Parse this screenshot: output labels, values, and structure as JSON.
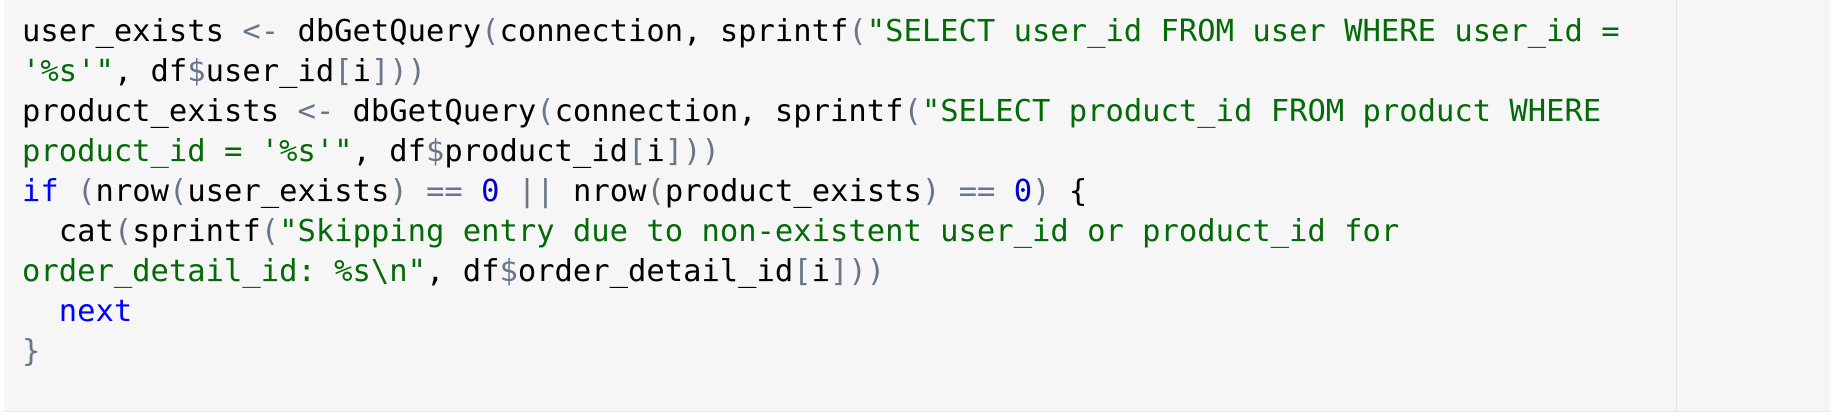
{
  "editor": {
    "colors": {
      "background": "#f6f6f6",
      "default_text": "#000000",
      "string": "#036a07",
      "keyword": "#0000ff",
      "number": "#0000cd",
      "operator": "#687687"
    },
    "lines": [
      {
        "id": "line-1",
        "tokens": [
          {
            "text": "user_exists ",
            "type": "plain"
          },
          {
            "text": "<-",
            "type": "op"
          },
          {
            "text": " dbGetQuery",
            "type": "plain"
          },
          {
            "text": "(",
            "type": "br"
          },
          {
            "text": "connection, sprintf",
            "type": "plain"
          },
          {
            "text": "(",
            "type": "br"
          },
          {
            "text": "\"SELECT user_id FROM user WHERE user_id =",
            "type": "str"
          }
        ]
      },
      {
        "id": "line-2",
        "tokens": [
          {
            "text": "'%s'\"",
            "type": "str"
          },
          {
            "text": ", df",
            "type": "plain"
          },
          {
            "text": "$",
            "type": "op"
          },
          {
            "text": "user_id",
            "type": "plain"
          },
          {
            "text": "[",
            "type": "br"
          },
          {
            "text": "i",
            "type": "plain"
          },
          {
            "text": "]))",
            "type": "br"
          }
        ]
      },
      {
        "id": "line-3",
        "tokens": [
          {
            "text": "product_exists ",
            "type": "plain"
          },
          {
            "text": "<-",
            "type": "op"
          },
          {
            "text": " dbGetQuery",
            "type": "plain"
          },
          {
            "text": "(",
            "type": "br"
          },
          {
            "text": "connection, sprintf",
            "type": "plain"
          },
          {
            "text": "(",
            "type": "br"
          },
          {
            "text": "\"SELECT product_id FROM product WHERE",
            "type": "str"
          }
        ]
      },
      {
        "id": "line-4",
        "tokens": [
          {
            "text": "product_id = '%s'\"",
            "type": "str"
          },
          {
            "text": ", df",
            "type": "plain"
          },
          {
            "text": "$",
            "type": "op"
          },
          {
            "text": "product_id",
            "type": "plain"
          },
          {
            "text": "[",
            "type": "br"
          },
          {
            "text": "i",
            "type": "plain"
          },
          {
            "text": "]))",
            "type": "br"
          }
        ]
      },
      {
        "id": "line-5",
        "tokens": [
          {
            "text": "if",
            "type": "kw"
          },
          {
            "text": " ",
            "type": "plain"
          },
          {
            "text": "(",
            "type": "br"
          },
          {
            "text": "nrow",
            "type": "plain"
          },
          {
            "text": "(",
            "type": "br"
          },
          {
            "text": "user_exists",
            "type": "plain"
          },
          {
            "text": ")",
            "type": "br"
          },
          {
            "text": " ",
            "type": "plain"
          },
          {
            "text": "==",
            "type": "op"
          },
          {
            "text": " ",
            "type": "plain"
          },
          {
            "text": "0",
            "type": "num"
          },
          {
            "text": " ",
            "type": "plain"
          },
          {
            "text": "||",
            "type": "op"
          },
          {
            "text": " nrow",
            "type": "plain"
          },
          {
            "text": "(",
            "type": "br"
          },
          {
            "text": "product_exists",
            "type": "plain"
          },
          {
            "text": ")",
            "type": "br"
          },
          {
            "text": " ",
            "type": "plain"
          },
          {
            "text": "==",
            "type": "op"
          },
          {
            "text": " ",
            "type": "plain"
          },
          {
            "text": "0",
            "type": "num"
          },
          {
            "text": ")",
            "type": "br"
          },
          {
            "text": " {",
            "type": "plain"
          }
        ]
      },
      {
        "id": "line-6",
        "tokens": [
          {
            "text": "  cat",
            "type": "plain"
          },
          {
            "text": "(",
            "type": "br"
          },
          {
            "text": "sprintf",
            "type": "plain"
          },
          {
            "text": "(",
            "type": "br"
          },
          {
            "text": "\"Skipping entry due to non-existent user_id or product_id for",
            "type": "str"
          }
        ]
      },
      {
        "id": "line-7",
        "tokens": [
          {
            "text": "order_detail_id: %s\\n\"",
            "type": "str"
          },
          {
            "text": ", df",
            "type": "plain"
          },
          {
            "text": "$",
            "type": "op"
          },
          {
            "text": "order_detail_id",
            "type": "plain"
          },
          {
            "text": "[",
            "type": "br"
          },
          {
            "text": "i",
            "type": "plain"
          },
          {
            "text": "]))",
            "type": "br"
          }
        ]
      },
      {
        "id": "line-8",
        "tokens": [
          {
            "text": "  ",
            "type": "plain"
          },
          {
            "text": "next",
            "type": "kw"
          }
        ]
      },
      {
        "id": "line-9",
        "tokens": [
          {
            "text": "}",
            "type": "br"
          }
        ]
      }
    ]
  }
}
